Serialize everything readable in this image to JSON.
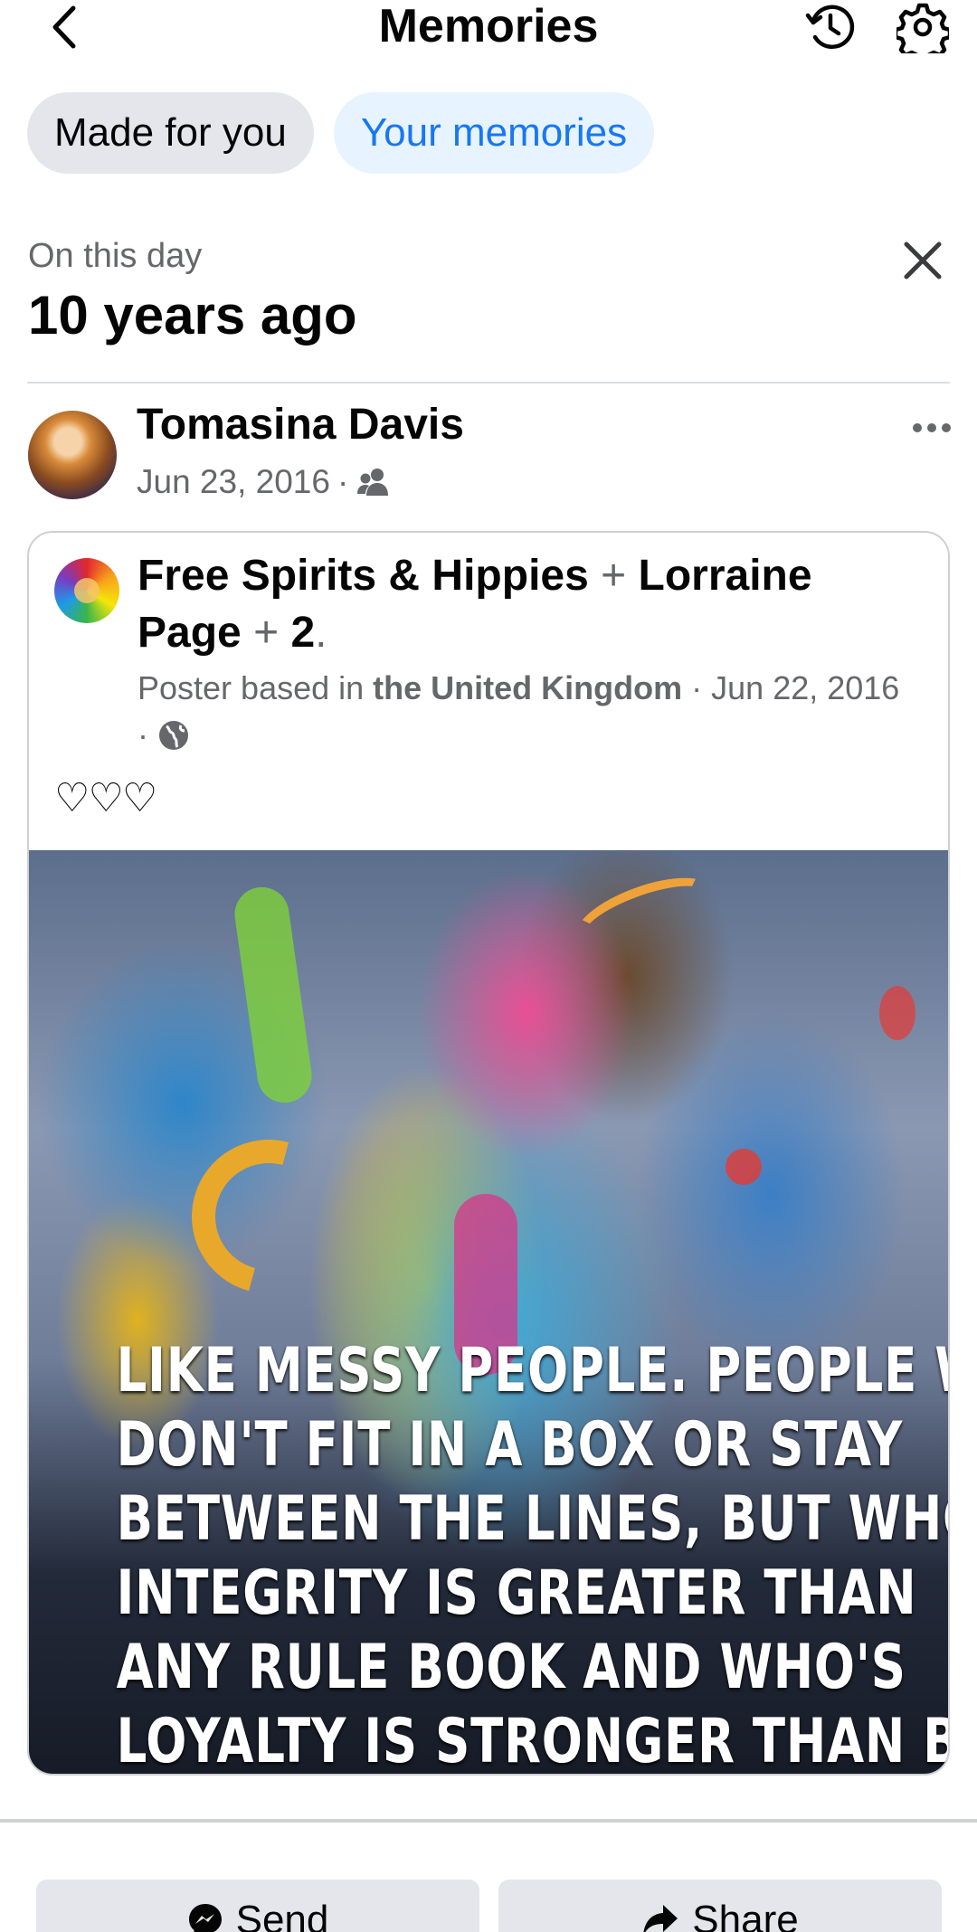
{
  "header": {
    "title": "Memories",
    "back_icon": "chevron-left-icon",
    "history_icon": "history-icon",
    "settings_icon": "gear-icon"
  },
  "tabs": [
    {
      "label": "Made for you",
      "selected": false
    },
    {
      "label": "Your memories",
      "selected": true
    }
  ],
  "section": {
    "label": "On this day",
    "title": "10 years ago"
  },
  "post": {
    "author": "Tomasina Davis",
    "date": "Jun 23, 2016",
    "separator": "·",
    "audience_icon": "friends-icon",
    "shared": {
      "group": "Free Spirits & Hippies",
      "plus": "+",
      "tag1": "Lorraine Page",
      "tag2": "2",
      "period": ".",
      "meta_prefix": "Poster based in",
      "location": "the United Kingdom",
      "meta_date": "· Jun 22, 2016 ·",
      "privacy_icon": "globe-icon",
      "caption": "♡♡♡",
      "image_text": "LIKE MESSY PEOPLE. PEOPLE WHO\nDON'T FIT IN A BOX OR STAY\nBETWEEN THE LINES, BUT WHO'S\nINTEGRITY IS GREATER THAN\nANY RULE BOOK AND WHO'S\nLOYALTY IS STRONGER THAN BLOOD"
    }
  },
  "actions": {
    "send": "Send",
    "share": "Share"
  },
  "colors": {
    "accent": "#1877f2",
    "selected_tab_bg": "#e7f3ff",
    "tab_bg": "#e4e6eb",
    "secondary_text": "#65676b"
  }
}
